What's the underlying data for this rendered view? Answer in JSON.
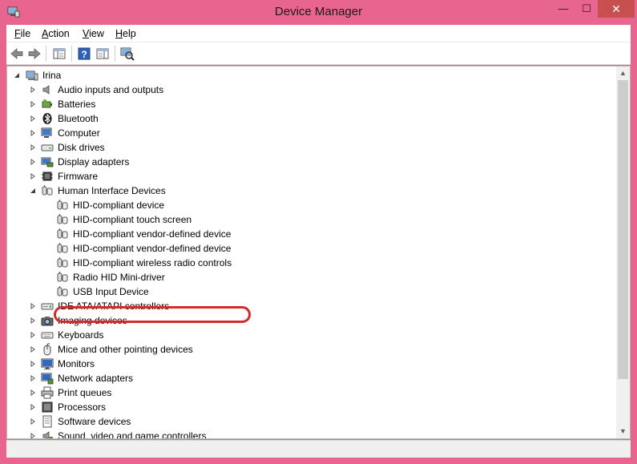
{
  "window": {
    "title": "Device Manager",
    "minimize": "—",
    "maximize": "☐",
    "close": "✕"
  },
  "menu": [
    {
      "accel": "F",
      "rest": "ile"
    },
    {
      "accel": "A",
      "rest": "ction"
    },
    {
      "accel": "V",
      "rest": "iew"
    },
    {
      "accel": "H",
      "rest": "elp"
    }
  ],
  "toolbar": {
    "icons": [
      "back-arrow-icon",
      "forward-arrow-icon",
      "show-hide-console-tree-icon",
      "help-icon",
      "properties-pane-icon",
      "scan-hardware-changes-icon"
    ]
  },
  "tree": {
    "root": "Irina",
    "categories_top": [
      {
        "label": "Audio inputs and outputs",
        "icon": "speaker-icon"
      },
      {
        "label": "Batteries",
        "icon": "battery-icon"
      },
      {
        "label": "Bluetooth",
        "icon": "bluetooth-icon"
      },
      {
        "label": "Computer",
        "icon": "computer-icon"
      },
      {
        "label": "Disk drives",
        "icon": "disk-drive-icon"
      },
      {
        "label": "Display adapters",
        "icon": "display-adapter-icon"
      },
      {
        "label": "Firmware",
        "icon": "firmware-icon"
      }
    ],
    "expanded": {
      "label": "Human Interface Devices",
      "icon": "hid-icon",
      "children": [
        "HID-compliant device",
        "HID-compliant touch screen",
        "HID-compliant vendor-defined device",
        "HID-compliant vendor-defined device",
        "HID-compliant wireless radio controls",
        "Radio HID Mini-driver",
        "USB Input Device"
      ],
      "highlighted_index": 3
    },
    "categories_bottom": [
      {
        "label": "IDE ATA/ATAPI controllers",
        "icon": "ide-controller-icon"
      },
      {
        "label": "Imaging devices",
        "icon": "camera-icon"
      },
      {
        "label": "Keyboards",
        "icon": "keyboard-icon"
      },
      {
        "label": "Mice and other pointing devices",
        "icon": "mouse-icon"
      },
      {
        "label": "Monitors",
        "icon": "monitor-icon"
      },
      {
        "label": "Network adapters",
        "icon": "network-adapter-icon"
      },
      {
        "label": "Print queues",
        "icon": "printer-icon"
      },
      {
        "label": "Processors",
        "icon": "processor-icon"
      },
      {
        "label": "Software devices",
        "icon": "software-device-icon"
      },
      {
        "label": "Sound, video and game controllers",
        "icon": "sound-controller-icon"
      }
    ]
  },
  "colors": {
    "title_bar": "#e8658f",
    "close_button": "#c7504f",
    "highlight_ring": "#d62a2a"
  }
}
